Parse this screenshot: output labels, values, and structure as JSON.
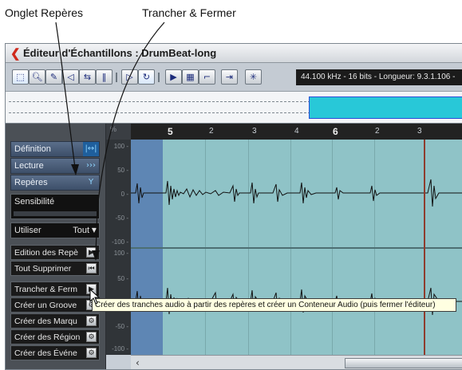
{
  "callouts": {
    "reperes": "Onglet Repères",
    "trancher": "Trancher & Fermer"
  },
  "window": {
    "title": "Éditeur d'Échantillons : DrumBeat-long",
    "info": "44.100 kHz - 16 bits - Longueur: 9.3.1.106 -"
  },
  "panel": {
    "tabs": [
      {
        "label": "Définition",
        "icon": "bracket-arrows-icon",
        "glyph": "|↔|"
      },
      {
        "label": "Lecture",
        "icon": "forward-arrows-icon",
        "glyph": "›››"
      },
      {
        "label": "Repères",
        "icon": "marker-icon",
        "glyph": "Y"
      }
    ],
    "sensitivity_label": "Sensibilité",
    "use_label": "Utiliser",
    "use_value": "Tout",
    "buttons": [
      {
        "label": "Edition des Repè",
        "icon": "play-triangle-icon",
        "glyph": "▶"
      },
      {
        "label": "Tout Supprimer",
        "icon": "skip-back-icon",
        "glyph": "⏮"
      },
      {
        "label": "Trancher & Ferm",
        "icon": "slice-icon",
        "glyph": "▶"
      },
      {
        "label": "Créer un Groove",
        "icon": "gear-icon",
        "glyph": "⚙"
      },
      {
        "label": "Créer des Marqu",
        "icon": "gear-icon",
        "glyph": "⚙"
      },
      {
        "label": "Créer des Région",
        "icon": "gear-icon",
        "glyph": "⚙"
      },
      {
        "label": "Créer des Événe",
        "icon": "gear-icon",
        "glyph": "⚙"
      }
    ]
  },
  "ruler": {
    "corner_label": "%",
    "ticks": [
      {
        "label": "5",
        "major": true
      },
      {
        "label": "2",
        "major": false
      },
      {
        "label": "3",
        "major": false
      },
      {
        "label": "4",
        "major": false
      },
      {
        "label": "6",
        "major": true
      },
      {
        "label": "2",
        "major": false
      },
      {
        "label": "3",
        "major": false
      }
    ]
  },
  "scale_labels": [
    "100 -",
    "50 -",
    "0 -",
    "-50 -",
    "-100 -",
    "100 -",
    "50 -",
    "0 -",
    "-50 -",
    "-100 -"
  ],
  "tooltip": "Créer des tranches audio à partir des repères et créer un Conteneur Audio (puis fermer l'éditeur)"
}
